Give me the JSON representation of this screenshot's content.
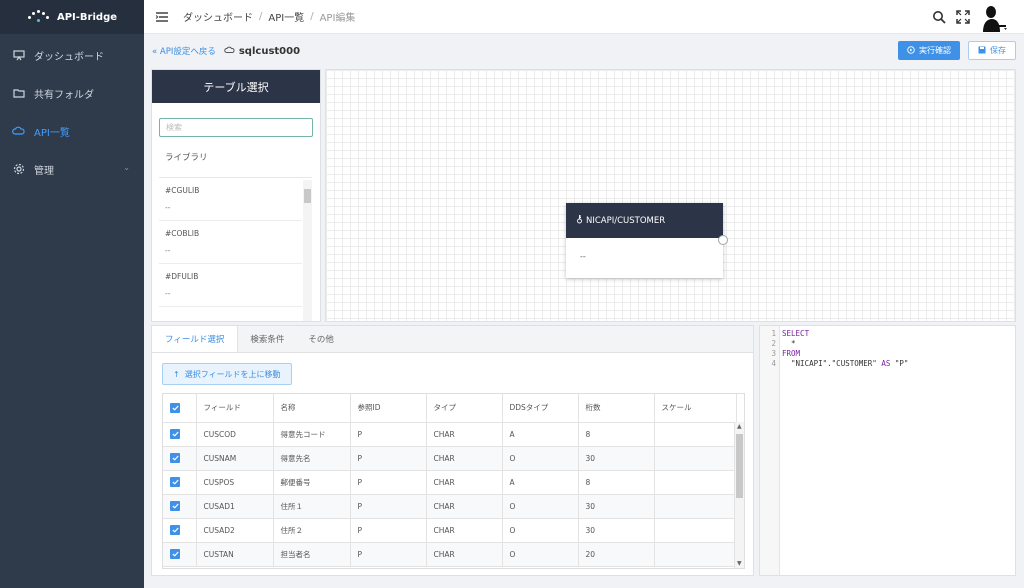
{
  "app": {
    "title": "API-Bridge"
  },
  "sidebar": {
    "items": [
      {
        "label": "ダッシュボード",
        "icon": "monitor-icon"
      },
      {
        "label": "共有フォルダ",
        "icon": "folder-icon"
      },
      {
        "label": "API一覧",
        "icon": "cloud-icon",
        "active": true
      },
      {
        "label": "管理",
        "icon": "gear-icon",
        "expandable": true
      }
    ]
  },
  "header": {
    "breadcrumb": [
      "ダッシュボード",
      "API一覧",
      "API編集"
    ],
    "icons": [
      "search-icon",
      "fullscreen-icon",
      "user-avatar"
    ]
  },
  "subbar": {
    "back_label": "« API設定へ戻る",
    "api_name": "sqlcust000",
    "run_label": "実行確認",
    "save_label": "保存"
  },
  "table_select": {
    "title": "テーブル選択",
    "search_placeholder": "検索",
    "library_header": "ライブラリ",
    "libraries": [
      {
        "name": "#CGULIB",
        "desc": "--"
      },
      {
        "name": "#COBLIB",
        "desc": "--"
      },
      {
        "name": "#DFULIB",
        "desc": "--"
      }
    ]
  },
  "canvas": {
    "node": {
      "title": "NICAPI/CUSTOMER",
      "body": "--"
    }
  },
  "fields": {
    "tabs": [
      "フィールド選択",
      "検索条件",
      "その他"
    ],
    "active_tab": 0,
    "move_up_label": "選択フィールドを上に移動",
    "columns": [
      "フィールド",
      "名称",
      "参照ID",
      "タイプ",
      "DDSタイプ",
      "桁数",
      "スケール"
    ],
    "rows": [
      {
        "checked": true,
        "field": "CUSCOD",
        "name": "得意先コード",
        "ref": "P",
        "type": "CHAR",
        "dds": "A",
        "len": "8",
        "scale": ""
      },
      {
        "checked": true,
        "field": "CUSNAM",
        "name": "得意先名",
        "ref": "P",
        "type": "CHAR",
        "dds": "O",
        "len": "30",
        "scale": ""
      },
      {
        "checked": true,
        "field": "CUSPOS",
        "name": "郵便番号",
        "ref": "P",
        "type": "CHAR",
        "dds": "A",
        "len": "8",
        "scale": ""
      },
      {
        "checked": true,
        "field": "CUSAD1",
        "name": "住所１",
        "ref": "P",
        "type": "CHAR",
        "dds": "O",
        "len": "30",
        "scale": ""
      },
      {
        "checked": true,
        "field": "CUSAD2",
        "name": "住所２",
        "ref": "P",
        "type": "CHAR",
        "dds": "O",
        "len": "30",
        "scale": ""
      },
      {
        "checked": true,
        "field": "CUSTAN",
        "name": "担当者名",
        "ref": "P",
        "type": "CHAR",
        "dds": "O",
        "len": "20",
        "scale": ""
      }
    ]
  },
  "sql": {
    "lines": [
      {
        "n": "1",
        "parts": [
          {
            "t": "SELECT",
            "k": true
          }
        ]
      },
      {
        "n": "2",
        "parts": [
          {
            "t": "  *",
            "k": false
          }
        ]
      },
      {
        "n": "3",
        "parts": [
          {
            "t": "FROM",
            "k": true
          }
        ]
      },
      {
        "n": "4",
        "parts": [
          {
            "t": "  \"NICAPI\".\"CUSTOMER\" ",
            "k": false
          },
          {
            "t": "AS",
            "k": true
          },
          {
            "t": " \"P\"",
            "k": false
          }
        ]
      }
    ]
  },
  "colors": {
    "accent": "#3f91e8",
    "sidebar": "#2f3a4a",
    "panel_head": "#2b3547"
  }
}
